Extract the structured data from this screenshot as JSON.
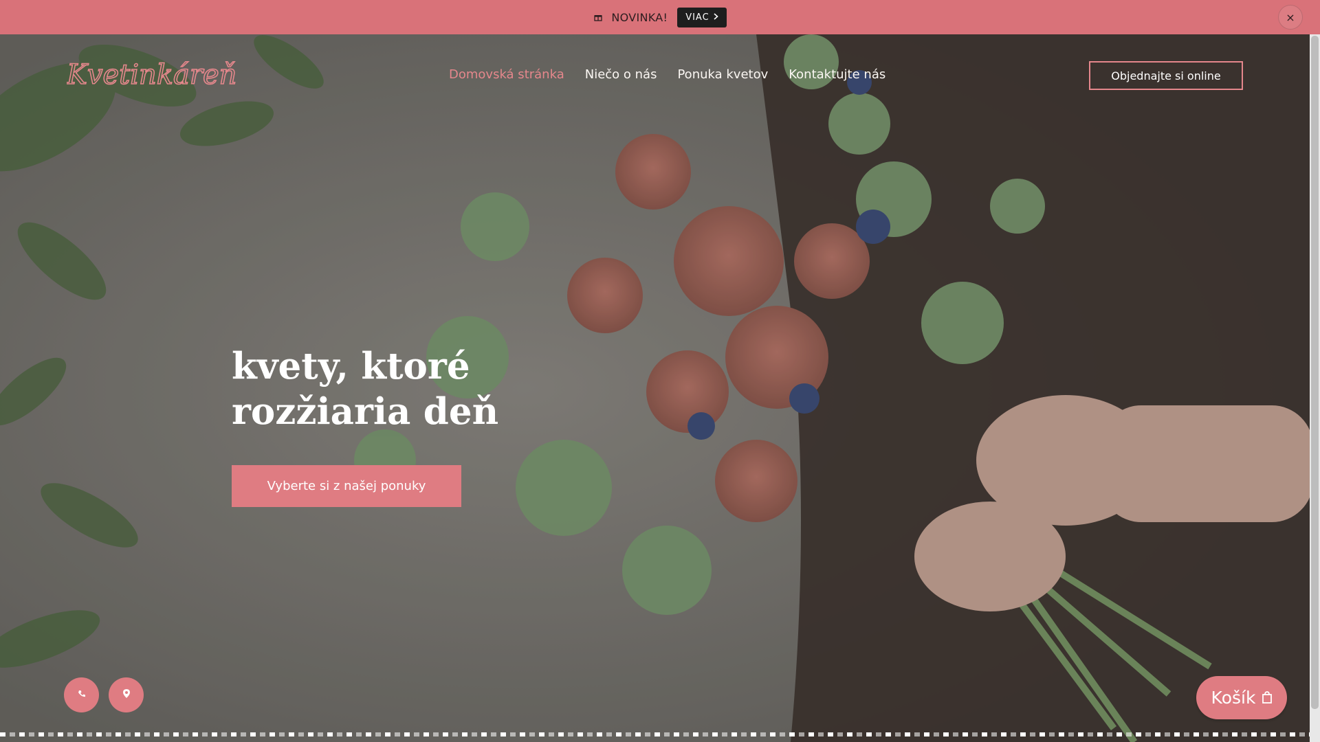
{
  "promo": {
    "icon": "gift-icon",
    "text": "NOVINKA!",
    "button_label": "VIAC",
    "button_icon": "chevron-right-icon",
    "close_label": "×"
  },
  "header": {
    "logo_text": "Kvetinkáreň",
    "nav": [
      {
        "label": "Domovská stránka",
        "active": true
      },
      {
        "label": "Niečo o nás",
        "active": false
      },
      {
        "label": "Ponuka kvetov",
        "active": false
      },
      {
        "label": "Kontaktujte nás",
        "active": false
      }
    ],
    "order_button": "Objednajte si online"
  },
  "hero": {
    "title": "kvety, ktoré rozžiaria deň",
    "cta_label": "Vyberte si z našej ponuky"
  },
  "floating": {
    "left_button_icon": "phone-icon",
    "right_button_icon": "map-marker-icon",
    "cart_label": "Košík",
    "cart_icon": "shopping-bag-icon"
  },
  "colors": {
    "accent": "#df7c82",
    "promo_bg": "#d97279",
    "promo_button": "#1e1e1e"
  }
}
